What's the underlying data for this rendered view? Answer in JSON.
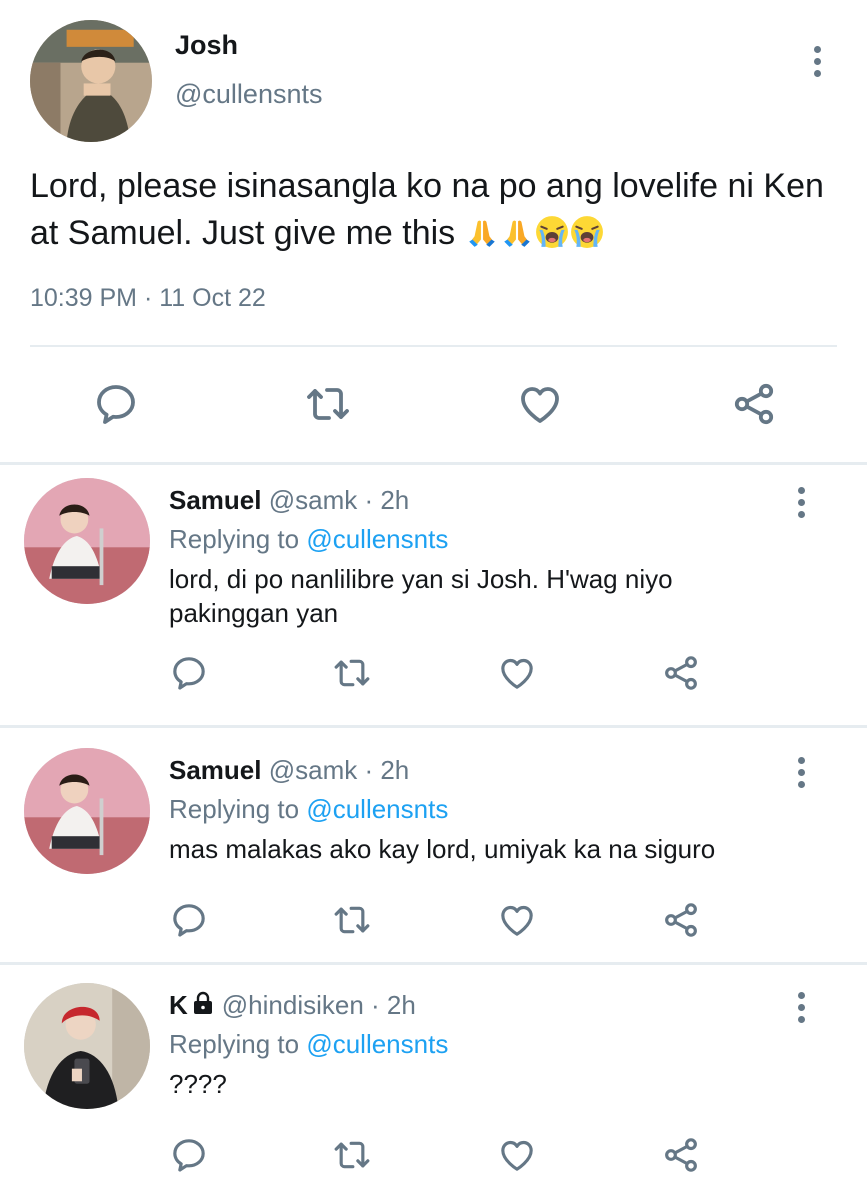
{
  "main_tweet": {
    "name": "Josh",
    "handle": "@cullensnts",
    "text": "Lord, please isinasangla ko na po ang lovelife ni Ken at Samuel. Just give me this",
    "emojis": [
      "folded-hands-emoji",
      "folded-hands-emoji",
      "loudly-crying-face-emoji",
      "loudly-crying-face-emoji"
    ],
    "timestamp": "10:39 PM · 11 Oct 22",
    "actions": [
      "reply-icon",
      "retweet-icon",
      "like-icon",
      "share-icon"
    ]
  },
  "replies": [
    {
      "name": "Samuel",
      "meta": "@samk · 2h",
      "replying_prefix": "Replying to ",
      "replying_to": "@cullensnts",
      "text": "lord, di po nanlilibre yan si Josh. H'wag niyo pakinggan yan"
    },
    {
      "name": "Samuel",
      "meta": "@samk · 2h",
      "replying_prefix": "Replying to ",
      "replying_to": "@cullensnts",
      "text": "mas malakas ako kay lord, umiyak ka na siguro"
    },
    {
      "name": "K",
      "protected_icon": "lock-icon",
      "meta": "@hindisiken · 2h",
      "replying_prefix": "Replying to ",
      "replying_to": "@cullensnts",
      "text": "????"
    }
  ],
  "colors": {
    "text": "#14171a",
    "secondary": "#657786",
    "link": "#1da1f2",
    "divider": "#e6ecf0",
    "icon": "#657786"
  }
}
